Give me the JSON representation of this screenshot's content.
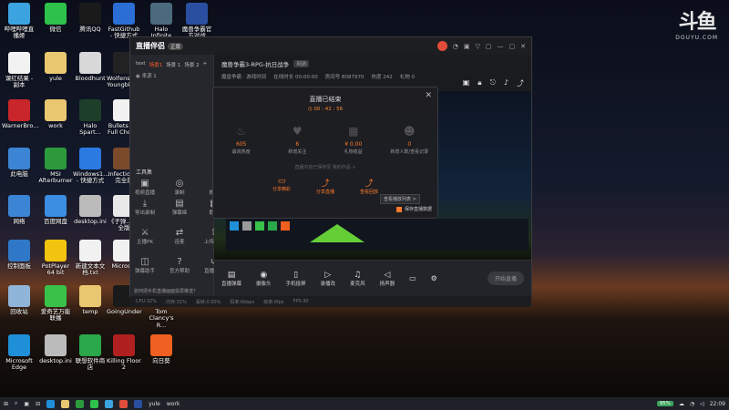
{
  "watermark": {
    "logo": "斗鱼",
    "sub": "DOUYU.COM"
  },
  "desktop_icons": [
    {
      "label": "哔哩哔哩直播姬",
      "color": "#3ba4e0"
    },
    {
      "label": "微信",
      "color": "#2ec24a"
    },
    {
      "label": "腾讯QQ",
      "color": "#1a1a1a"
    },
    {
      "label": "FastGithub - 快捷方式",
      "color": "#2b6fd6"
    },
    {
      "label": "Halo Infinite",
      "color": "#4b6a7e"
    },
    {
      "label": "魔兽争霸官方对战",
      "color": "#2a4fa0"
    },
    {
      "label": "课红结果 - 副本",
      "color": "#f2f2f2"
    },
    {
      "label": "yule",
      "color": "#e9c770"
    },
    {
      "label": "Bloodhunt",
      "color": "#d8d8d8"
    },
    {
      "label": "Wolfenstein Youngblood",
      "color": "#222"
    },
    {
      "label": "WarnerBro...",
      "color": "#c8262a"
    },
    {
      "label": "work",
      "color": "#e9c770"
    },
    {
      "label": "Halo Spart...",
      "color": "#1d3f2a"
    },
    {
      "label": "Bullets Per Full Chorus",
      "color": "#f1f1f1"
    },
    {
      "label": "此电脑",
      "color": "#3b85d4"
    },
    {
      "label": "MSI Afterburner",
      "color": "#2c9a3c"
    },
    {
      "label": "Windows1... - 快捷方式",
      "color": "#2a7ae2"
    },
    {
      "label": "Infection... 完全版",
      "color": "#7a4a2a"
    },
    {
      "label": "网络",
      "color": "#3b85d4"
    },
    {
      "label": "百度网盘",
      "color": "#3a8de0"
    },
    {
      "label": "desktop.ini",
      "color": "#bbb"
    },
    {
      "label": "《子弹... 完全版",
      "color": "#e8e8e8"
    },
    {
      "label": "控制面板",
      "color": "#2f78c8"
    },
    {
      "label": "PotPlayer 64 bit",
      "color": "#f1c40f"
    },
    {
      "label": "新建文本文档.txt",
      "color": "#f1f1f1"
    },
    {
      "label": "Micros...",
      "color": "#f1f1f1"
    },
    {
      "label": "回收站",
      "color": "#8fb5d9"
    },
    {
      "label": "爱奇艺万能联播",
      "color": "#38c24a"
    },
    {
      "label": "temp",
      "color": "#e9c770"
    },
    {
      "label": "GoingUnder",
      "color": "#1a1a1a"
    },
    {
      "label": "Tom Clancy's R...",
      "color": "#e8e8e8"
    },
    {
      "label": "Microsoft Edge",
      "color": "#1f8fd8"
    },
    {
      "label": "desktop.ini",
      "color": "#bbb"
    },
    {
      "label": "联想软件商店",
      "color": "#2aa84a"
    },
    {
      "label": "Killing Floor 2",
      "color": "#b02020"
    },
    {
      "label": "向日葵",
      "color": "#f06020"
    }
  ],
  "app": {
    "title": "直播伴侣",
    "title_tag": "正版",
    "window_controls": [
      "◔",
      "▣",
      "▽",
      "▢",
      "—",
      "▢",
      "✕"
    ],
    "scene_tabs": [
      "test",
      "场景1",
      "场景 1",
      "场景 2",
      "+"
    ],
    "source_label": "来源 1",
    "tools_heading": "工具集",
    "tools_row1": [
      "视频直播",
      "录制",
      "推流"
    ],
    "tools_row2": [
      "导出录制",
      "弹幕姬",
      "数据"
    ],
    "tools_row3": [
      "主播PK",
      "连麦",
      "上传一帧"
    ],
    "tools_row4": [
      "弹幕助手",
      "官方帮助",
      "直播回放"
    ],
    "room_title": "魔兽争霸3-RPG-抗日战争",
    "room_badge": "网游",
    "room_category": "魔兽争霸 · 游戏时间",
    "room_stats": [
      "在线时长 00:00:00",
      "房间号 8087970",
      "热度 242",
      "礼物 0"
    ],
    "bottom_tools": [
      "直播弹幕",
      "摄像头",
      "手机投屏",
      "录播改",
      "麦克风",
      "扬声器"
    ],
    "start_label": "开始直播",
    "statusbar": [
      "CPU:32%",
      "内存:31%",
      "丢帧:0.00%",
      "码率:0kbps",
      "帧率:0fps",
      "FPS:30"
    ],
    "tip": "如何把手机直播画面投屏推送？",
    "modal": {
      "title": "直播已结束",
      "time": "00 : 42 : 56",
      "stats": [
        {
          "icon": "fire-icon",
          "value": "605",
          "key": "最高热度"
        },
        {
          "icon": "heart-icon",
          "value": "6",
          "key": "新增关注"
        },
        {
          "icon": "gift-icon",
          "value": "¥ 0.00",
          "key": "礼物收益"
        },
        {
          "icon": "user-icon",
          "value": "0",
          "key": "新增人数/查看记录"
        }
      ],
      "note": "直播内容已保存至 我的作品 >",
      "actions": [
        "分享精彩",
        "分享直播",
        "查看回放"
      ],
      "save_checkbox": "保存直播数据",
      "tooltip": "查看播放列表 >"
    }
  },
  "taskbar": {
    "left": [
      "⊞",
      "⌕",
      "▣",
      "⊟"
    ],
    "items": [
      "yule",
      "work"
    ],
    "battery": "95%",
    "time": "22:09"
  }
}
